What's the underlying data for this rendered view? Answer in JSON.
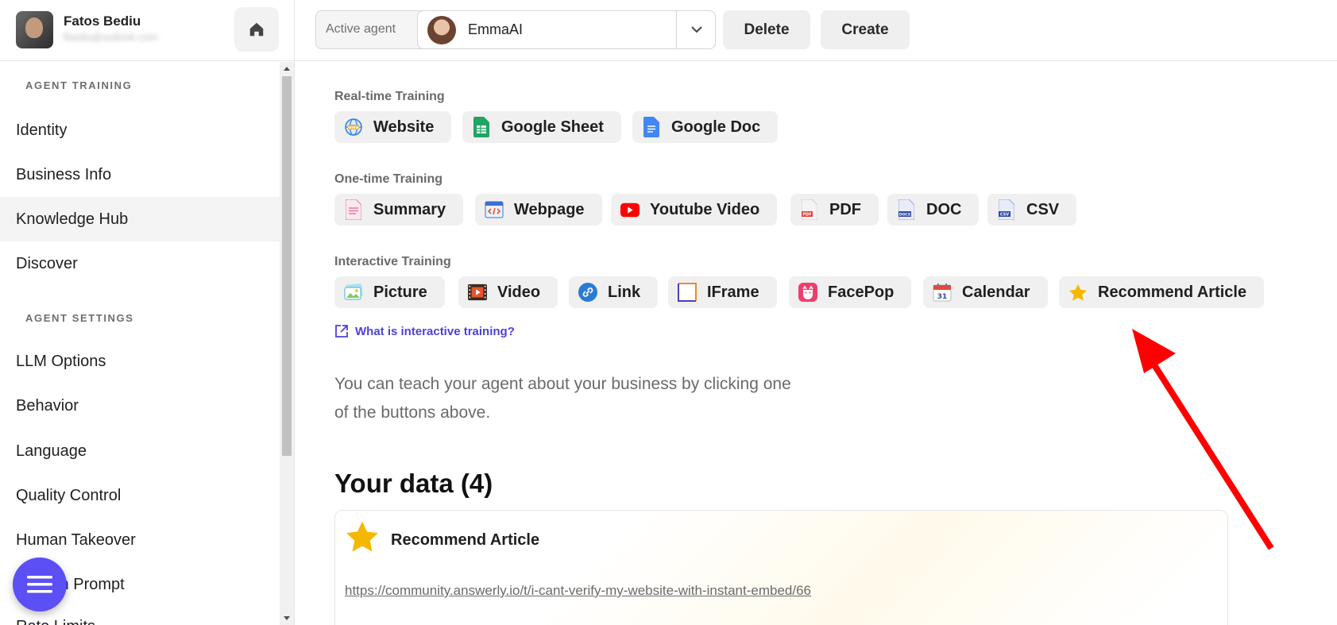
{
  "user": {
    "name": "Fatos Bediu",
    "email": "fbediu@outlook.com"
  },
  "sidebar": {
    "agent_training_title": "AGENT TRAINING",
    "agent_settings_title": "AGENT SETTINGS",
    "training_items": [
      {
        "label": "Identity"
      },
      {
        "label": "Business Info"
      },
      {
        "label": "Knowledge Hub",
        "active": true
      },
      {
        "label": "Discover"
      }
    ],
    "settings_items": [
      {
        "label": "LLM Options"
      },
      {
        "label": "Behavior"
      },
      {
        "label": "Language"
      },
      {
        "label": "Quality Control"
      },
      {
        "label": "Human Takeover"
      },
      {
        "label": "System Prompt"
      },
      {
        "label": "Rate Limits"
      }
    ]
  },
  "topbar": {
    "active_agent_label": "Active agent",
    "agent_name": "EmmaAI",
    "delete_label": "Delete",
    "create_label": "Create"
  },
  "training": {
    "realtime_title": "Real-time Training",
    "realtime": [
      {
        "label": "Website",
        "icon": "globe-icon"
      },
      {
        "label": "Google Sheet",
        "icon": "google-sheet-icon"
      },
      {
        "label": "Google Doc",
        "icon": "google-doc-icon"
      }
    ],
    "onetime_title": "One-time Training",
    "onetime": [
      {
        "label": "Summary",
        "icon": "summary-doc-icon"
      },
      {
        "label": "Webpage",
        "icon": "webpage-code-icon"
      },
      {
        "label": "Youtube Video",
        "icon": "youtube-icon"
      },
      {
        "label": "PDF",
        "icon": "pdf-file-icon"
      },
      {
        "label": "DOC",
        "icon": "docx-file-icon"
      },
      {
        "label": "CSV",
        "icon": "csv-file-icon"
      }
    ],
    "interactive_title": "Interactive Training",
    "interactive": [
      {
        "label": "Picture",
        "icon": "picture-icon"
      },
      {
        "label": "Video",
        "icon": "film-icon"
      },
      {
        "label": "Link",
        "icon": "link-icon"
      },
      {
        "label": "IFrame",
        "icon": "iframe-icon"
      },
      {
        "label": "FacePop",
        "icon": "facepop-icon"
      },
      {
        "label": "Calendar",
        "icon": "calendar-icon"
      },
      {
        "label": "Recommend Article",
        "icon": "star-icon"
      }
    ],
    "help_link": "What is interactive training?",
    "intro": "You can teach your agent about your business by clicking one of the buttons above."
  },
  "data_section": {
    "heading": "Your data (4)",
    "card": {
      "title": "Recommend Article",
      "url": "https://community.answerly.io/t/i-cant-verify-my-website-with-instant-embed/66"
    }
  },
  "colors": {
    "accent": "#5b4ff5",
    "link": "#4b43d6",
    "annotation_arrow": "#ff0000",
    "star": "#f5b800"
  }
}
